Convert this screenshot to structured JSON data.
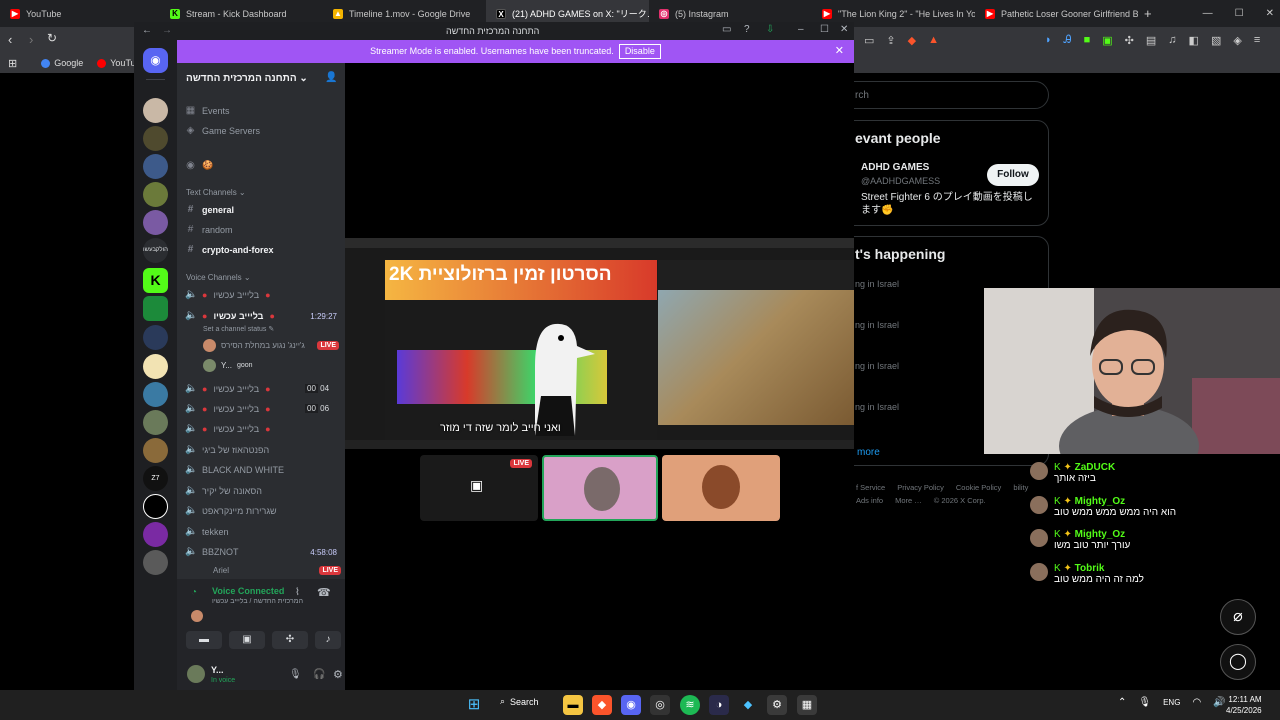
{
  "browser": {
    "tabs": [
      {
        "label": "YouTube",
        "icon": "youtube-icon",
        "color": "#ff0000"
      },
      {
        "label": "Stream - Kick Dashboard",
        "icon": "kick-icon",
        "color": "#53fc18"
      },
      {
        "label": "Timeline 1.mov - Google Drive",
        "icon": "drive-icon",
        "color": "#f4b400"
      },
      {
        "label": "(21) ADHD GAMES on X: \"リーク…",
        "icon": "x-icon",
        "color": "#ffffff"
      },
      {
        "label": "(5) Instagram",
        "icon": "instagram-icon",
        "color": "#e1306c"
      },
      {
        "label": "\"The Lion King 2\" - \"He Lives In You\"",
        "icon": "youtube-icon",
        "color": "#ff0000"
      },
      {
        "label": "Pathetic Loser Gooner Girlfriend Beg",
        "icon": "youtube-icon",
        "color": "#ff0000"
      }
    ],
    "bookmarks": [
      {
        "label": "Google",
        "icon": "google-icon"
      },
      {
        "label": "YouTube",
        "icon": "youtube-icon"
      }
    ]
  },
  "x_page": {
    "search_placeholder": "rch",
    "relevant_title": "evant people",
    "person_name": "ADHD GAMES",
    "person_handle": "@AADHDGAMESS",
    "person_bio": "Street Fighter 6 のプレイ動画を投稿します✊",
    "follow_label": "Follow",
    "happening_title": "t's happening",
    "trend_lines": [
      "ng in Israel",
      "ng in Israel",
      "ng in Israel",
      "ng in Israel"
    ],
    "show_more": "more",
    "footer": [
      "f Service",
      "Privacy Policy",
      "Cookie Policy",
      "bility",
      "Ads info",
      "More …",
      "© 2026 X Corp."
    ]
  },
  "discord": {
    "window_title": "התחנה המרכזית החדשה",
    "streamer_banner": "Streamer Mode is enabled. Usernames have been truncated.",
    "disable_label": "Disable",
    "server_name": "התחנה המרכזית החדשה",
    "events_label": "Events",
    "game_servers_label": "Game Servers",
    "text_channels_label": "Text Channels",
    "text_channels": [
      "general",
      "random",
      "crypto-and-forex"
    ],
    "voice_channels_label": "Voice Channels",
    "voice_channels": [
      "בליייב עכשיו",
      "בליייב עכשיו",
      "בליייב עכשיו",
      "בליייב עכשיו",
      "בליייב עכשיו",
      "הפנטהאוז של ביגי",
      "BLACK AND WHITE",
      "הסאונה של יקיר",
      "שגרירות מיינקראפט",
      "tekken",
      "BBZNOT"
    ],
    "active_timer": "1:29:27",
    "set_status": "Set a channel status",
    "member1": "ג'יינג' נגוע במחלת הסירס",
    "member2": "Y...",
    "member2_tag": "goon",
    "live_label": "LIVE",
    "count1a": "00",
    "count1b": "04",
    "count2a": "00",
    "count2b": "06",
    "bbznot_timer": "4:58:08",
    "bbznot_member": "Ariel",
    "voice_connected": "Voice Connected",
    "voice_sub": "התחנה המרכזית החדשה / בליייב עכשיו",
    "user_name": "Y...",
    "user_status": "In voice",
    "stream_overlay_title": "2K הסרטון זמין ברזולוציית",
    "stream_caption": "ואני חייב לומר שזה די מוזר"
  },
  "chat": [
    {
      "user": "ZaDUCK",
      "text": "ביזה אותך"
    },
    {
      "user": "Mighty_Oz",
      "text": "הוא היה ממש ממש ממש טוב"
    },
    {
      "user": "Mighty_Oz",
      "text": "עורך יותר טוב משו"
    },
    {
      "user": "Tobrik",
      "text": "למה זה היה ממש טוב"
    }
  ],
  "taskbar": {
    "search_label": "Search",
    "lang": "ENG",
    "time": "12:11 AM",
    "date": "4/25/2026"
  }
}
